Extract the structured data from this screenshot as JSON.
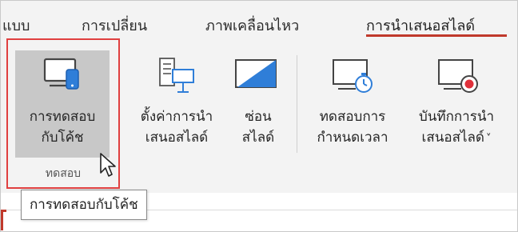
{
  "tabs": [
    {
      "label": "แบบ"
    },
    {
      "label": "การเปลี่ยน"
    },
    {
      "label": "ภาพเคลื่อนไหว"
    },
    {
      "label": "การนำเสนอสไลด์",
      "active": true
    }
  ],
  "accent_color": "#c0392b",
  "highlight_color": "#e04040",
  "ribbon": {
    "rehearse_group": {
      "button": {
        "line1": "การทดสอบ",
        "line2": "กับโค้ช",
        "icon": "presenter-coach-icon"
      },
      "group_label": "ทดสอบ"
    },
    "setup_slide_show": {
      "line1": "ตั้งค่าการนำ",
      "line2": "เสนอสไลด์",
      "icon": "setup-slideshow-icon"
    },
    "hide_slide": {
      "line1": "ซ่อน",
      "line2": "สไลด์",
      "icon": "hide-slide-icon"
    },
    "rehearse_timings": {
      "line1": "ทดสอบการ",
      "line2": "กำหนดเวลา",
      "icon": "rehearse-timings-icon"
    },
    "record_slide_show": {
      "line1": "บันทึกการนำ",
      "line2": "เสนอสไลด์",
      "dropdown": "˅",
      "icon": "record-slideshow-icon"
    }
  },
  "tooltip": {
    "text": "การทดสอบกับโค้ช"
  }
}
